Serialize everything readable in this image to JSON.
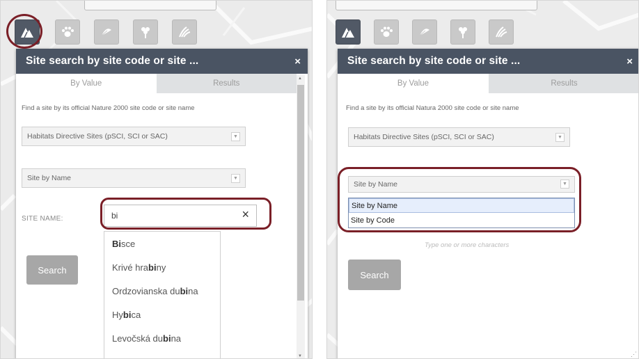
{
  "left": {
    "panel_title": "Site search by site code or site ...",
    "close_glyph": "×",
    "tabs": [
      "By Value",
      "Results"
    ],
    "helper_text": "Find a site by its official Nature 2000 site code or site name",
    "site_type_select": "Habitats Directive Sites (pSCI, SCI or SAC)",
    "search_by_select": "Site by Name",
    "site_name_label": "SITE NAME:",
    "site_name_value": "bi",
    "clear_glyph": "×",
    "search_button": "Search",
    "suggestions": [
      {
        "pre": "",
        "match": "Bi",
        "post": "sce"
      },
      {
        "pre": "Krivé hra",
        "match": "bi",
        "post": "ny"
      },
      {
        "pre": "Ordzovianska du",
        "match": "bi",
        "post": "na"
      },
      {
        "pre": "Hy",
        "match": "bi",
        "post": "ca"
      },
      {
        "pre": "Levočská du",
        "match": "bi",
        "post": "na"
      }
    ]
  },
  "right": {
    "panel_title": "Site search by site code or site ...",
    "close_glyph": "×",
    "tabs": [
      "By Value",
      "Results"
    ],
    "helper_text": "Find a site by its official Natura 2000 site code or site name",
    "site_type_select": "Habitats Directive Sites (pSCI, SCI or SAC)",
    "search_by_select": "Site by Name",
    "dropdown_options": [
      "Site by Name",
      "Site by Code"
    ],
    "hint_text": "Type one or more characters",
    "search_button": "Search"
  },
  "icons": [
    "mountain-icon",
    "paw-icon",
    "plant-icon",
    "flower-icon",
    "habitat-icon"
  ],
  "colors": {
    "titlebar": "#4a5463",
    "active_tool": "#515966",
    "callout": "#7a1f27",
    "button": "#a7a7a7"
  }
}
